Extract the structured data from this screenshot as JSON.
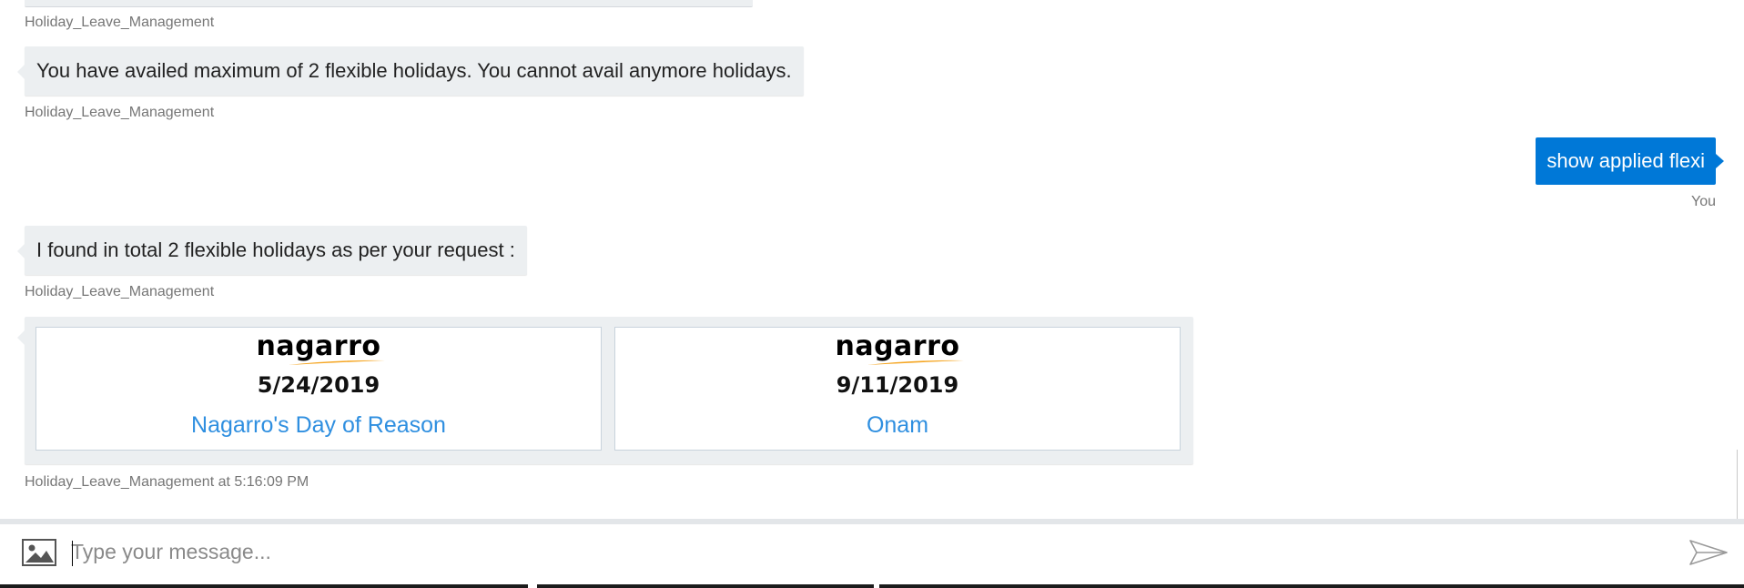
{
  "messages": {
    "bot_sender_1": "Holiday_Leave_Management",
    "bot_text_2": "You have availed maximum of 2 flexible holidays. You cannot avail anymore holidays.",
    "bot_sender_2": "Holiday_Leave_Management",
    "user_text": "show applied flexi",
    "user_sender": "You",
    "bot_text_3": "I found in total 2 flexible holidays as per your request :",
    "bot_sender_3": "Holiday_Leave_Management",
    "cards_footer": "Holiday_Leave_Management at 5:16:09 PM"
  },
  "cards": [
    {
      "logo": "nagarro",
      "date": "5/24/2019",
      "title": "Nagarro's Day of Reason"
    },
    {
      "logo": "nagarro",
      "date": "9/11/2019",
      "title": "Onam"
    }
  ],
  "composer": {
    "placeholder": "Type your message...",
    "value": "",
    "upload_icon": "image-upload-icon",
    "send_icon": "send-icon"
  },
  "colors": {
    "user_bubble": "#0078d7",
    "bot_bubble": "#eceff1",
    "card_title": "#2f8fe0",
    "logo_swoosh": "#f5a623"
  }
}
